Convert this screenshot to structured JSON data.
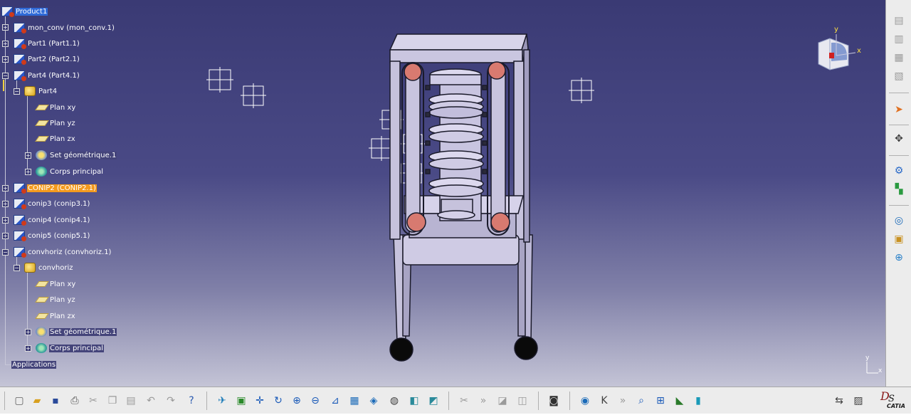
{
  "tree": {
    "root": "Product1",
    "items": [
      {
        "label": "mon_conv (mon_conv.1)"
      },
      {
        "label": "Part1 (Part1.1)"
      },
      {
        "label": "Part2 (Part2.1)"
      },
      {
        "label": "Part4 (Part4.1)"
      },
      {
        "label": "Part4"
      },
      {
        "label": "Plan xy"
      },
      {
        "label": "Plan yz"
      },
      {
        "label": "Plan zx"
      },
      {
        "label": "Set géométrique.1"
      },
      {
        "label": "Corps principal"
      },
      {
        "label": "CONIP2 (CONIP2.1)"
      },
      {
        "label": "conip3 (conip3.1)"
      },
      {
        "label": "conip4 (conip4.1)"
      },
      {
        "label": "conip5 (conip5.1)"
      },
      {
        "label": "convhoriz (convhoriz.1)"
      },
      {
        "label": "convhoriz"
      },
      {
        "label": "Plan xy"
      },
      {
        "label": "Plan yz"
      },
      {
        "label": "Plan zx"
      },
      {
        "label": "Set géométrique.1"
      },
      {
        "label": "Corps principal"
      }
    ],
    "applications": "Applications"
  },
  "compass": {
    "x_label": "x",
    "y_label": "y"
  },
  "mini_axis": {
    "x_label": "x",
    "y_label": "y"
  },
  "logo": {
    "text": "CATIA"
  },
  "colors": {
    "highlight": "#f39a1e",
    "selection": "#2f6ad8"
  }
}
